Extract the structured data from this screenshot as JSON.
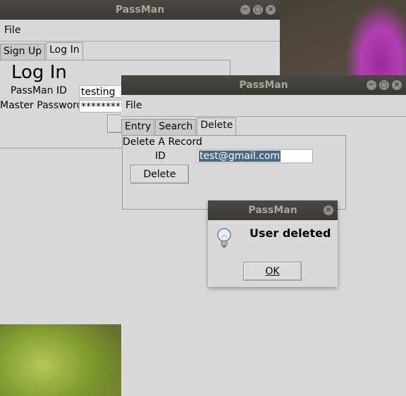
{
  "window1": {
    "title": "PassMan",
    "menu": {
      "file": "File"
    },
    "tabs": [
      {
        "label": "Sign Up"
      },
      {
        "label": "Log In"
      }
    ],
    "heading": "Log In",
    "id_label": "PassMan ID",
    "id_value": "testing",
    "password_label": "Master Password",
    "password_value": "********"
  },
  "window2": {
    "title": "PassMan",
    "menu": {
      "file": "File"
    },
    "tabs": [
      {
        "label": "Entry"
      },
      {
        "label": "Search"
      },
      {
        "label": "Delete"
      }
    ],
    "section_title": "Delete A Record",
    "id_label": "ID",
    "id_value": "test@gmail.com",
    "delete_button": "Delete"
  },
  "dialog": {
    "title": "PassMan",
    "message": "User deleted",
    "ok_button": "OK",
    "icon": "lightbulb-info-icon"
  },
  "window_buttons": {
    "minimize": "−",
    "maximize": "□",
    "close": "×"
  }
}
